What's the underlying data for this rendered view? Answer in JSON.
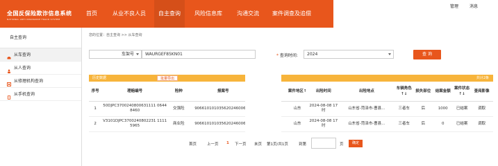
{
  "header": {
    "logo_title": "全国反保险欺诈信息系统",
    "logo_subtitle": "NATIONAL ANTI INSURANCE FRAUD SYSTEM",
    "nav": [
      "首页",
      "从业不良人员",
      "自主查询",
      "风险信息库",
      "沟通交流",
      "案件调查及追偿"
    ],
    "active_nav_index": 2,
    "corner_labels": [
      "管理",
      "消息"
    ]
  },
  "sidebar": {
    "title": "自主查询",
    "items": [
      {
        "label": "从车查询",
        "icon": "car-icon"
      },
      {
        "label": "从人查询",
        "icon": "person-icon"
      },
      {
        "label": "从修理机构查询",
        "icon": "wrench-icon"
      },
      {
        "label": "从手机查询",
        "icon": "phone-icon"
      }
    ],
    "active_index": 0
  },
  "breadcrumb": "您的位置：自主查询 >> 从车查询",
  "filters": {
    "type_select": "车架号",
    "vin_value": "WAURGEF85KN01",
    "time_label": "查询时间:",
    "time_select": "2024",
    "query_button": "查 询"
  },
  "results": {
    "bar_label": "历史数据",
    "export_label": "批量导出",
    "total_text": "共计2条",
    "columns": [
      "序号",
      "理赔编号",
      "险种",
      "报案号",
      "",
      "案件地区↑",
      "出险时间",
      "出险地点",
      "车辆角色↑↓",
      "损失部位",
      "结案金额",
      "案件状态↑↓",
      "查阅影像"
    ],
    "rows": [
      [
        "1",
        "50DJPC3700240800631111 06448460",
        "交强险",
        "9066101010356202460065 6",
        "",
        "山东",
        "2024-08-08 17 时",
        "山东省-菏泽市-曹县...",
        "三者车",
        "后",
        "1000",
        "已结案",
        "调取"
      ],
      [
        "2",
        "V3101DJPC3700240802231 11115965",
        "商业险",
        "9066101010356202460065 6",
        "",
        "山东",
        "2024-08-08 17 时",
        "山东省-菏泽市-曹县...",
        "三者车",
        "后",
        "0",
        "已结案",
        "调取"
      ]
    ]
  },
  "pager": {
    "first": "首页",
    "prev": "上一页",
    "current": "1",
    "next": "下一页",
    "last": "末页",
    "summary": "第1页/共1页",
    "goto_label": "到第",
    "page_suffix": "页",
    "confirm": "确定"
  },
  "colors": {
    "brand": "#e8561c",
    "result_bar": "#f7b43b"
  }
}
